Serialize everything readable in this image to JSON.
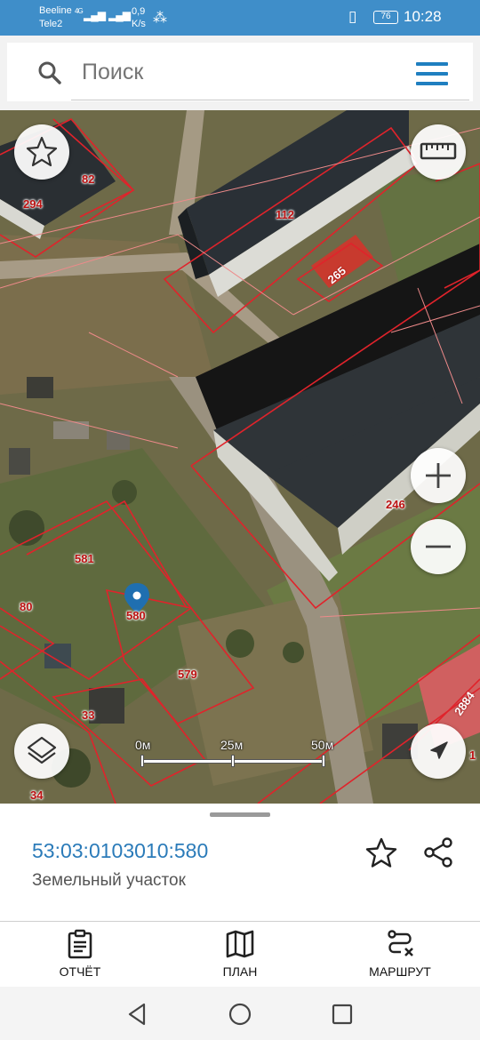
{
  "status_bar": {
    "carrier1": "Beeline",
    "carrier2": "Tele2",
    "net1": "4G",
    "speed_value": "0,9",
    "speed_unit": "K/s",
    "battery": "76",
    "time": "10:28"
  },
  "search": {
    "placeholder": "Поиск"
  },
  "map": {
    "parcel_labels": [
      "294",
      "82",
      "112",
      "265",
      "581",
      "80",
      "580",
      "579",
      "33",
      "34",
      "246",
      "2884",
      "1"
    ],
    "scale_labels": [
      "0м",
      "25м",
      "50м"
    ],
    "boundary_color": "#e0232b"
  },
  "sheet": {
    "cadastral_number": "53:03:0103010:580",
    "object_type": "Земельный участок"
  },
  "tabs": [
    {
      "label": "ОТЧЁТ",
      "icon": "report-icon"
    },
    {
      "label": "ПЛАН",
      "icon": "map-icon"
    },
    {
      "label": "МАРШРУТ",
      "icon": "route-icon"
    }
  ],
  "colors": {
    "status_bar": "#3f8ec9",
    "accent": "#2b7bb9"
  }
}
